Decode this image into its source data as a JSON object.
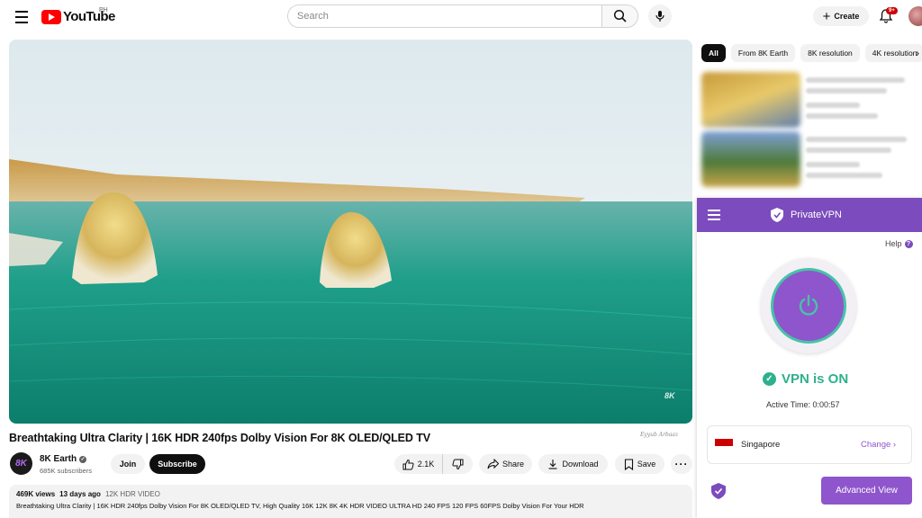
{
  "header": {
    "logo_text": "YouTube",
    "country_code": "PH",
    "search_placeholder": "Search",
    "create_label": "Create",
    "notification_badge": "9+"
  },
  "video": {
    "watermark": "8K",
    "title": "Breathtaking Ultra Clarity | 16K HDR 240fps Dolby Vision For 8K OLED/QLED TV",
    "signature": "Eyyub Arbaaz"
  },
  "channel": {
    "avatar_text": "8K",
    "name": "8K Earth",
    "subscribers": "685K subscribers",
    "join_label": "Join",
    "subscribe_label": "Subscribe"
  },
  "actions": {
    "likes": "2.1K",
    "share_label": "Share",
    "download_label": "Download",
    "save_label": "Save"
  },
  "description": {
    "views": "469K views",
    "age": "13 days ago",
    "tag": "12K HDR VIDEO",
    "text": "Breathtaking Ultra Clarity | 16K HDR 240fps Dolby Vision For 8K OLED/QLED TV, High Quality 16K 12K 8K 4K HDR VIDEO ULTRA HD 240 FPS 120 FPS 60FPS Dolby Vision For Your HDR"
  },
  "chips": [
    "All",
    "From 8K Earth",
    "8K resolution",
    "4K resolution"
  ],
  "vpn": {
    "brand": "PrivateVPN",
    "help_label": "Help",
    "status": "VPN is ON",
    "active_time_label": "Active Time:",
    "active_time": "0:00:57",
    "location": "Singapore",
    "change_label": "Change",
    "advanced_label": "Advanced View",
    "accent_color": "#8f55cc",
    "status_color": "#2eb08c"
  }
}
